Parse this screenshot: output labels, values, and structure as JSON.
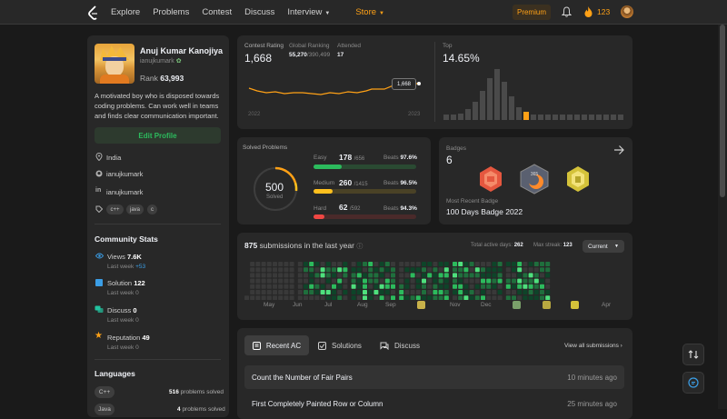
{
  "nav": {
    "links": [
      "Explore",
      "Problems",
      "Contest",
      "Discuss",
      "Interview"
    ],
    "store": "Store",
    "premium": "Premium",
    "streak": "123"
  },
  "profile": {
    "name": "Anuj Kumar Kanojiya",
    "username": "ianujkumark",
    "rank_label": "Rank",
    "rank": "63,993",
    "bio": [
      "A motivated boy who is disposed towards",
      "coding problems. Can work well in teams",
      "and finds clear communication important."
    ],
    "edit": "Edit Profile",
    "location": "India",
    "github": "ianujkumark",
    "linkedin": "ianujkumark",
    "skills": [
      "c++",
      "java",
      "c"
    ]
  },
  "community": {
    "title": "Community Stats",
    "items": [
      {
        "label": "Views",
        "value": "7.6K",
        "sub": "Last week",
        "delta": "+53",
        "color": "#3b9ee6"
      },
      {
        "label": "Solution",
        "value": "122",
        "sub": "Last week",
        "delta": "0",
        "color": "#3b9ee6"
      },
      {
        "label": "Discuss",
        "value": "0",
        "sub": "Last week",
        "delta": "0",
        "color": "#22c3a0"
      },
      {
        "label": "Reputation",
        "value": "49",
        "sub": "Last week",
        "delta": "0",
        "color": "#ffa116"
      }
    ]
  },
  "languages": {
    "title": "Languages",
    "items": [
      {
        "name": "C++",
        "count": "516",
        "unit": "problems solved"
      },
      {
        "name": "Java",
        "count": "4",
        "unit": "problems solved"
      }
    ]
  },
  "contest": {
    "rating_label": "Contest Rating",
    "rating": "1,668",
    "global_label": "Global Ranking",
    "global": "55,270",
    "global_total": "/390,499",
    "attended_label": "Attended",
    "attended": "17",
    "tooltip": "1,668",
    "year_start": "2022",
    "year_end": "2023",
    "top_label": "Top",
    "top": "14.65%"
  },
  "solved": {
    "title": "Solved Problems",
    "total": "500",
    "total_label": "Solved",
    "rows": [
      {
        "level": "Easy",
        "count": "178",
        "total": "/656",
        "beats_label": "Beats",
        "beats": "97.6%",
        "color": "#2cbb5d",
        "fraction": 0.27
      },
      {
        "level": "Medium",
        "count": "260",
        "total": "/1415",
        "beats_label": "Beats",
        "beats": "96.5%",
        "color": "#ffc01e",
        "fraction": 0.18
      },
      {
        "level": "Hard",
        "count": "62",
        "total": "/592",
        "beats_label": "Beats",
        "beats": "94.3%",
        "color": "#ef4743",
        "fraction": 0.1
      }
    ]
  },
  "badges": {
    "label": "Badges",
    "count": "6",
    "recent_label": "Most Recent Badge",
    "recent": "100 Days Badge 2022"
  },
  "heatmap": {
    "count": "875",
    "label": "submissions in the last year",
    "active_label": "Total active days:",
    "active": "262",
    "streak_label": "Max streak:",
    "streak": "123",
    "period": "Current",
    "months": [
      "May",
      "Jun",
      "Jul",
      "Aug",
      "Sep",
      "Nov",
      "Dec",
      "Apr"
    ]
  },
  "recent": {
    "tabs": [
      "Recent AC",
      "Solutions",
      "Discuss"
    ],
    "view_all": "View all submissions",
    "items": [
      {
        "title": "Count the Number of Fair Pairs",
        "time": "10 minutes ago"
      },
      {
        "title": "First Completely Painted Row or Column",
        "time": "25 minutes ago"
      }
    ]
  }
}
